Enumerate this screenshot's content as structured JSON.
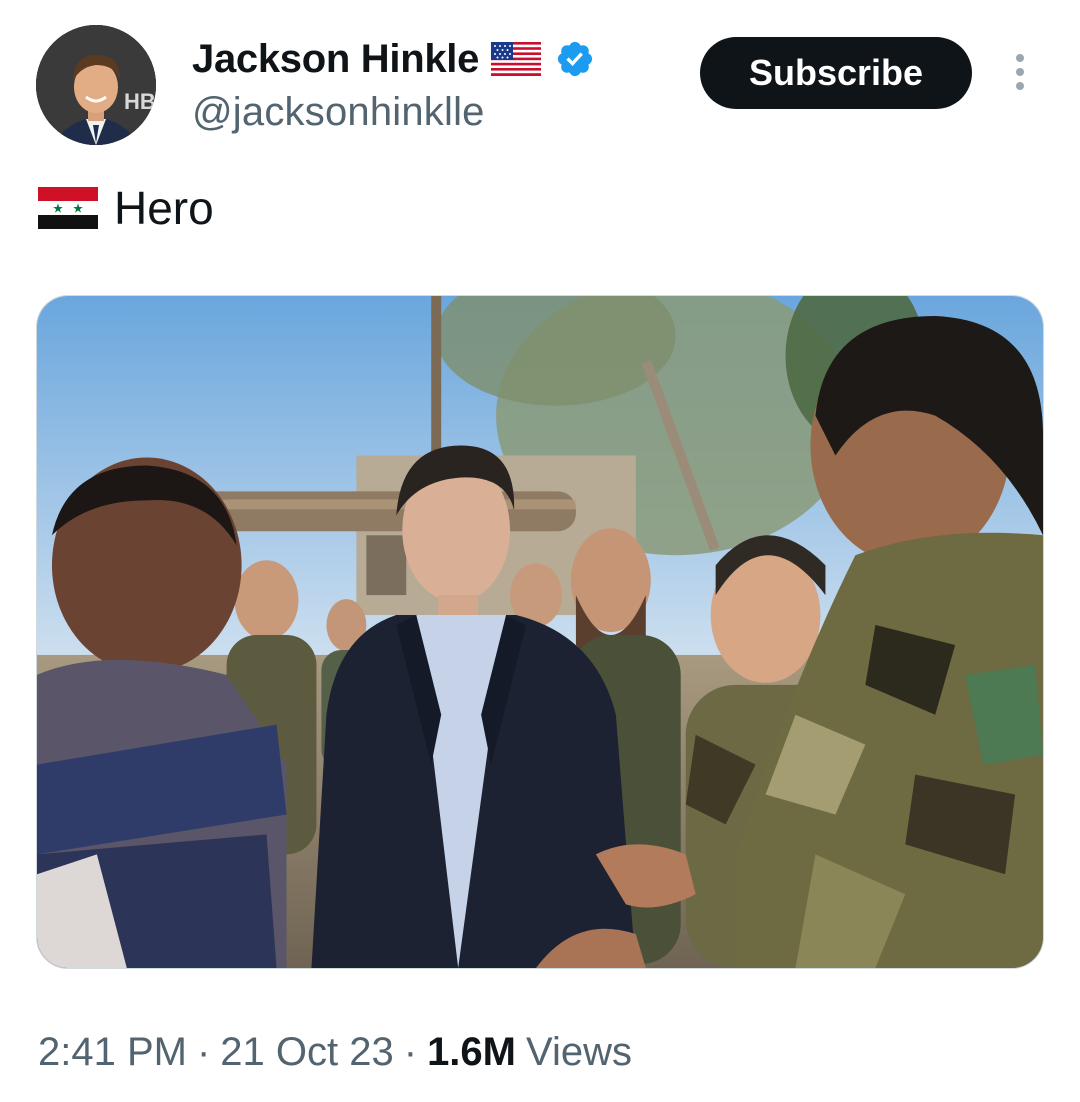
{
  "author": {
    "display_name": "Jackson Hinkle",
    "handle": "@jacksonhinklle",
    "avatar_text": "HB",
    "name_flag_icon": "us-flag-icon",
    "verified_icon": "verified-badge-icon"
  },
  "header": {
    "subscribe_label": "Subscribe",
    "more_icon": "more-vertical-icon"
  },
  "tweet": {
    "flag_icon": "syria-flag-icon",
    "text": "Hero"
  },
  "media": {
    "type": "photo"
  },
  "meta": {
    "time": "2:41 PM",
    "separator": "·",
    "date": "21 Oct 23",
    "views_count": "1.6M",
    "views_label": "Views"
  },
  "colors": {
    "text_primary": "#0f1419",
    "text_secondary": "#536471",
    "verified_blue": "#1d9bf0",
    "subscribe_bg": "#0f1419"
  }
}
